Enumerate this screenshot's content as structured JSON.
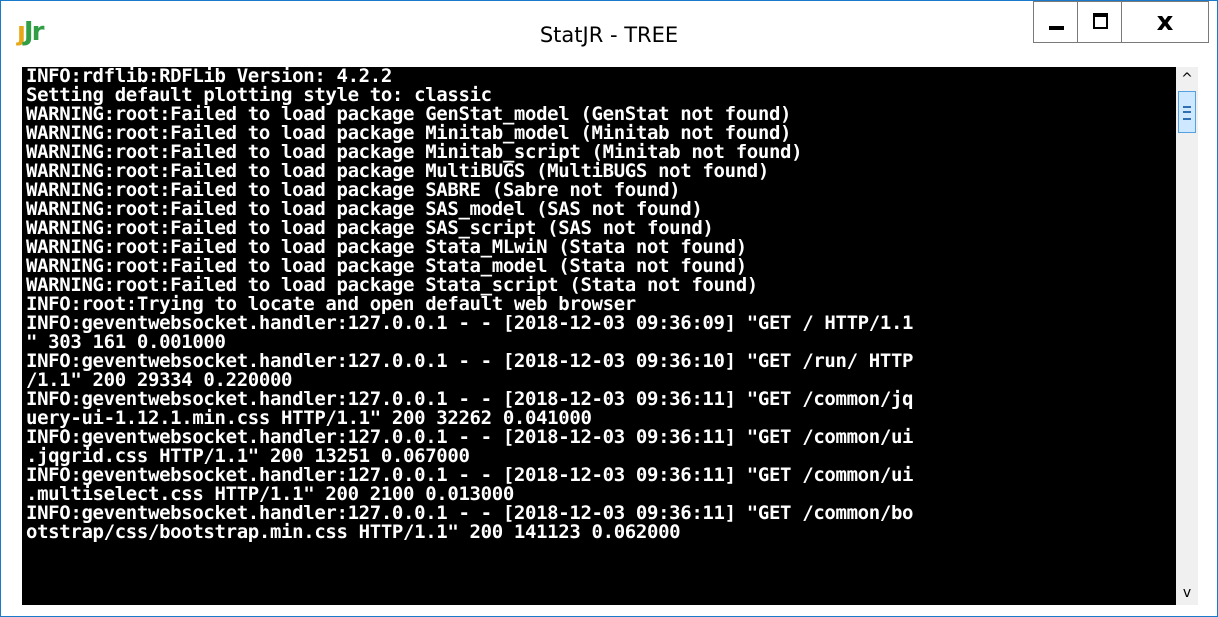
{
  "window": {
    "title": "StatJR - TREE",
    "icon": "statjr-app-icon",
    "icon_text_a": "ȷ",
    "icon_text_b": "Jr",
    "close_glyph": "x",
    "scroll_up_glyph": "^",
    "scroll_down_glyph": "v"
  },
  "console": {
    "lines": [
      "INFO:rdflib:RDFLib Version: 4.2.2",
      "Setting default plotting style to: classic",
      "WARNING:root:Failed to load package GenStat_model (GenStat not found)",
      "WARNING:root:Failed to load package Minitab_model (Minitab not found)",
      "WARNING:root:Failed to load package Minitab_script (Minitab not found)",
      "WARNING:root:Failed to load package MultiBUGS (MultiBUGS not found)",
      "WARNING:root:Failed to load package SABRE (Sabre not found)",
      "WARNING:root:Failed to load package SAS_model (SAS not found)",
      "WARNING:root:Failed to load package SAS_script (SAS not found)",
      "WARNING:root:Failed to load package Stata_MLwiN (Stata not found)",
      "WARNING:root:Failed to load package Stata_model (Stata not found)",
      "WARNING:root:Failed to load package Stata_script (Stata not found)",
      "INFO:root:Trying to locate and open default web browser",
      "INFO:geventwebsocket.handler:127.0.0.1 - - [2018-12-03 09:36:09] \"GET / HTTP/1.1",
      "\" 303 161 0.001000",
      "INFO:geventwebsocket.handler:127.0.0.1 - - [2018-12-03 09:36:10] \"GET /run/ HTTP",
      "/1.1\" 200 29334 0.220000",
      "INFO:geventwebsocket.handler:127.0.0.1 - - [2018-12-03 09:36:11] \"GET /common/jq",
      "uery-ui-1.12.1.min.css HTTP/1.1\" 200 32262 0.041000",
      "INFO:geventwebsocket.handler:127.0.0.1 - - [2018-12-03 09:36:11] \"GET /common/ui",
      ".jqgrid.css HTTP/1.1\" 200 13251 0.067000",
      "INFO:geventwebsocket.handler:127.0.0.1 - - [2018-12-03 09:36:11] \"GET /common/ui",
      ".multiselect.css HTTP/1.1\" 200 2100 0.013000",
      "INFO:geventwebsocket.handler:127.0.0.1 - - [2018-12-03 09:36:11] \"GET /common/bo",
      "otstrap/css/bootstrap.min.css HTTP/1.1\" 200 141123 0.062000"
    ]
  },
  "colors": {
    "console_bg": "#000000",
    "console_text": "#ffffff",
    "window_border": "#1979ca",
    "scroll_thumb": "#cde8ff"
  }
}
